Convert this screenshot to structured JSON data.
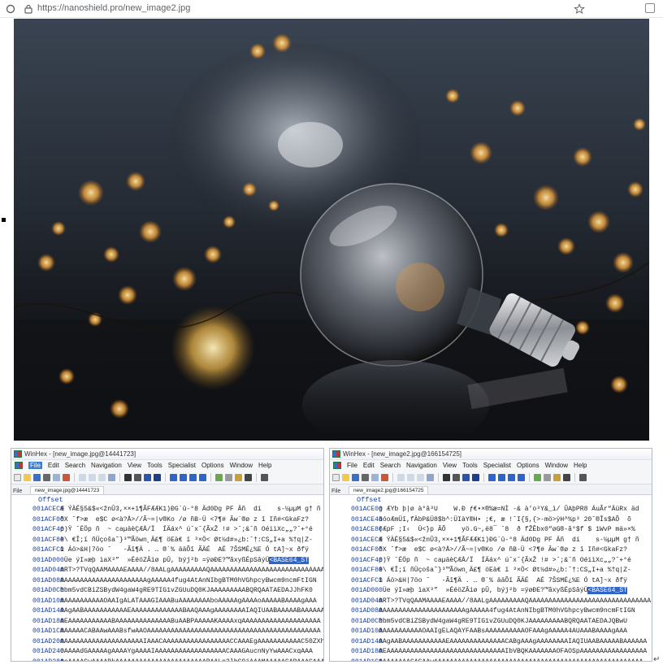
{
  "browser": {
    "url": "https://nanoshield.pro/new_image2.jpg"
  },
  "photo": {
    "subject": "glass light bulb with bokeh lights"
  },
  "left_pane": {
    "title": "WinHex - [new_image.jpg@14441723]",
    "menu": [
      "File",
      "Edit",
      "Search",
      "Navigation",
      "View",
      "Tools",
      "Specialist",
      "Options",
      "Window",
      "Help"
    ],
    "file_label": "File",
    "tab": "new_image.jpg@14441723",
    "offset_header": "Offset",
    "rows": [
      {
        "offset": "001ACEC0",
        "text": "Æ ÝÀÉ§5&$«<žnÛ3,××+1¶ÃFÆÆK1)ÐG´û-°8 Äd0Dg PF Äñ  dí    s-½µµM g† ñ"
      },
      {
        "offset": "001ACF00",
        "text": "õX ˆf>æ  e$C ø<à?Å>//Ã~=|v®Ko /ø ñB-Ü <7¶# Âw´®ø z î Iñ#<GkaFz?"
      },
      {
        "offset": "001ACF40",
        "text": "p)Ÿ ˆÉÖp ñ  ~ caµäèÇÆÅ/Ï  ÍÄáx^ úˆxˆ{ÃxŽ !# >ˆ;&ˆñ OéiìXc„„?ˆ+°é"
      },
      {
        "offset": "001ACF80",
        "text": "è\\ €Î;ï ñÜçoša˜}³™Ãöwn¸Ä£¶ öEà€ ï ³×Ö< Øt½d#»¿b:ˆ†:CS„I+a %†q|Z-"
      },
      {
        "offset": "001ACFC0",
        "text": "ì Áö>&H|7öo ˆ   -Ãî¶Ä . … ®´% ääÕî ÃÄÉ  AÉ 7ŠSMÉ¿%E Ó tA]~x ðfÿ"
      },
      {
        "offset": "001AD000",
        "text": " Üe ýI»æþ ìaX³”  »ÉéöZÂiø pÛ, býj²b =ÿøÐE?™ãxyßÉpSâýÜ<BASE64_ST"
      },
      {
        "offset": "001AD040",
        "text": "ART>?TVqQAAMAAAAEAAAA//8AALgAAAAAAAAAQAAAAAAAAAAAAAAAAAAAAAAAAAAAAAAAA"
      },
      {
        "offset": "001AD080",
        "text": "AAAAAAAAAAAAAAAAAAAAAAgAAAAA4fug4AtAnNIbgBTM0hVGhpcyBwcm9ncmFtIGN"
      },
      {
        "offset": "001AD0C0",
        "text": "hbm5vdCBiZSBydW4gaW4gRE9TIG1vZGUuDQ0KJAAAAAAAAABQRQAATAEDAJJhFK0"
      },
      {
        "offset": "001AD100",
        "text": "AAAAAAAAAAAOAAIgALATAAAGIAAABuAAAAAAAAboAAAAAgAAAAoAAAAABAAAAgAAA"
      },
      {
        "offset": "001AD140",
        "text": "AAgAABAAAAAAAAAAAEAAAAAAAAAAAAABAAQAAAgAAAAAAAAIAQIUAABAAAAABAAAAAA"
      },
      {
        "offset": "001AD180",
        "text": "AEAAAAAAAAAAABAAAAAAAAAAAAAABuAABPAAAAAKAAAAxqAAAAAAAAAAAAAAAAAAAA"
      },
      {
        "offset": "001AD1C0",
        "text": "AAAAAACABAAwAAABsfwAAOAAAAAAAAAAAAAAAAAAAAAAAAAAAAAAAAAAAAAAAAAAAA"
      },
      {
        "offset": "001AD200",
        "text": "AAAAAAAAAAAAAAAAAAAAAIAAACAAAAAAAAAAAAAAAAACCAAAEgAAAAAAAAAAAC50ZXh"
      },
      {
        "offset": "001AD240",
        "text": "0AAAAdGAAAAAgAAAAYgAAAAIAAAAAAAAAAAAAAAAAACAAAGAucnNyYwAAACxqAAA"
      },
      {
        "offset": "001AD280",
        "text": "AoAAAAGwAAAABkAAAAAAAAAAAAAAAAAAAAAAABAALn3lbG9jAAAMAAAAACABAAACAAA"
      },
      {
        "offset": "001AD2C0",
        "text": "A0AAAAAAAAAAAAAAAAAAAAAAQAAAQgAAAAAAAAAAAAAAAAAAABPgAAAAAAAAEgAAAA"
      }
    ]
  },
  "right_pane": {
    "title": "WinHex - [new_image2.jpg@166154725]",
    "menu": [
      "File",
      "Edit",
      "Search",
      "Navigation",
      "View",
      "Tools",
      "Specialist",
      "Options",
      "Window",
      "Help"
    ],
    "file_label": "File",
    "tab": "new_image2.jpg@166154725",
    "offset_header": "Offset",
    "rows": [
      {
        "offset": "001ACE00",
        "text": "g ÆYb þ|ø à°â³U    W.Ð ƒ€•×®%æ=NÌ -& à’o³Y&_ì/ ÛAþPR8 ÁuÃr“ÄüRx äd"
      },
      {
        "offset": "001ACE40",
        "text": "äóoÆmÜî,fÀbP&Ü8$b^:ÜIàY®H• ;€, æ !ˆI{§,{>-mö>ÿH^%p³ 20ˆ®Îs$AÕ  õ"
      },
      {
        "offset": "001ACE80",
        "text": "(ÆpF ;I‹  Ü<}p ÂÕ    yö.G~,ë8¯ ˆ8  ð fŽÊbx0“øG®-ã°$f $ 1WvP mä»×%"
      },
      {
        "offset": "001ACEC0",
        "text": "Æ ÝÀÉ§5&$«<žnÛ3,××+1¶ÃFÆÆK1)ÐG´û-°8 Äd0Dg PF Äñ  dí    s-½µµM g† ñ"
      },
      {
        "offset": "001ACF00",
        "text": "õX ˆf>æ  e$C ø<à?Å>//Ã~=|v®Ko /ø ñB-Ü <7¶# Âw´®ø z î Iñ#<GkaFz?"
      },
      {
        "offset": "001ACF40",
        "text": "p)Ÿ ˆÉÖp ñ  ~ caµäèÇÆÅ/Ï  ÍÄáx^ úˆxˆ{ÃxŽ !# >ˆ;&ˆñ OéiìXc„„?ˆ+°é"
      },
      {
        "offset": "001ACF80",
        "text": "è\\ €Î;ï ñÜçoša˜}³™Ãöwn¸Ä£¶ öEà€ ï ³×Ö< Øt½d#»¿b:ˆ†:CS„I+a %†q|Z-"
      },
      {
        "offset": "001ACFC0",
        "text": "ì Áö>&H|7öo ˆ   -Ãî¶Ä . … ®´% ääÕî ÃÄÉ  AÉ 7ŠSMÉ¿%E Ó tA]~x ðfÿ"
      },
      {
        "offset": "001AD000",
        "text": " Üe ýI»æþ ìaX³”  »ÉéöZÂiø pÛ, býj²b =ÿøÐE?™ãxyßÉpSâýÜ<BASE64_ST"
      },
      {
        "offset": "001AD040",
        "text": "ART>?TVqQAAMAAAAEAAAA//8AALgAAAAAAAAAQAAAAAAAAAAAAAAAAAAAAAAAAAAAAAAA"
      },
      {
        "offset": "001AD080",
        "text": "AAAAAAAAAAAAAAAAAAAAAAgAAAAA4fug4AtAnNIbgBTM0hVGhpcyBwcm9ncmFtIGN"
      },
      {
        "offset": "001AD0C0",
        "text": "hbm5vdCBiZSBydW4gaW4gRE9TIG1vZGUuDQ0KJAAAAAAAAABQRQAATAEDAJQBwU"
      },
      {
        "offset": "001AD100",
        "text": "AAAAAAAAAAAOAAIgELAQAYFAABsAAAAAAAAAAOFAAAgAAAAA4AUAAABAAAAgAAA"
      },
      {
        "offset": "001AD140",
        "text": "AAgAABAAAAAAAAAAAEAAAAAAAAAAAAAACABgAAAgAAAAAAAAIAQIUAABAAAAABAAAAAA"
      },
      {
        "offset": "001AD180",
        "text": "AEAAAAAAAAAAAAAAAAAAAAAAAAAAAAAAIbVBQKAAAAAAAOFAOSpAAAAAAAAAAAAAAAAA"
      },
      {
        "offset": "001AD1C0",
        "text": "AAAAAAAAGAGAAwAAAAAAAAAAAAAAAAAAAAAAAAAAAAAAAAAAAAAAAAAAAAAAAAAAAAA"
      },
      {
        "offset": "001AD200",
        "text": "AAAAAAAAAAAAAAAAAAAAAIAAACAAAAAAAAAAAAAAAAACCAAAEgAAAAAAAAAAAC50ZXh"
      }
    ]
  },
  "colors": {
    "highlight": "#2f64c8",
    "offset_text": "#1a3f9c",
    "winhex_border": "#b5bcc8"
  }
}
